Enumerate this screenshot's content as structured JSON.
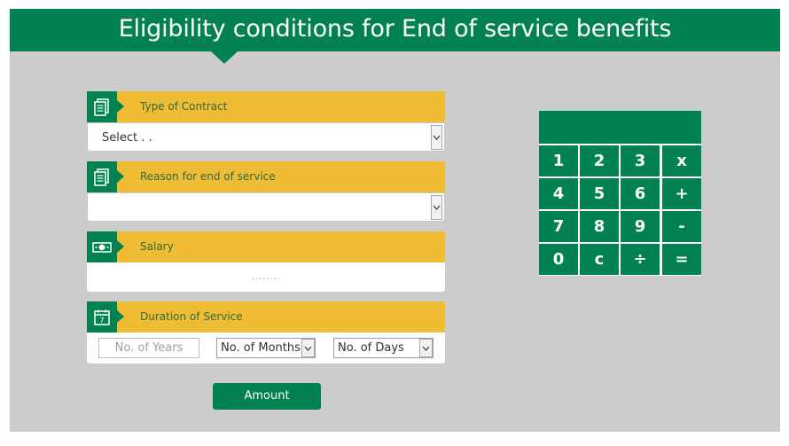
{
  "header": {
    "title": "Eligibility conditions for End of service benefits"
  },
  "contract": {
    "label": "Type of Contract",
    "value": "Select . .",
    "icon": "document-icon"
  },
  "reason": {
    "label": "Reason for end of service",
    "value": "",
    "icon": "document-icon"
  },
  "salary": {
    "label": "Salary",
    "placeholder": "........",
    "icon": "money-icon"
  },
  "duration": {
    "label": "Duration of Service",
    "icon": "calendar-icon",
    "calendar_digit": "7",
    "years_placeholder": "No. of Years",
    "months_value": "No. of Months",
    "days_value": "No. of Days"
  },
  "amount_button": "Amount",
  "calculator": {
    "keys": [
      "1",
      "2",
      "3",
      "x",
      "4",
      "5",
      "6",
      "+",
      "7",
      "8",
      "9",
      "-",
      "0",
      "c",
      "÷",
      "="
    ]
  },
  "colors": {
    "brand_green": "#028250",
    "accent_yellow": "#f0bc33",
    "background_gray": "#cccccc"
  }
}
